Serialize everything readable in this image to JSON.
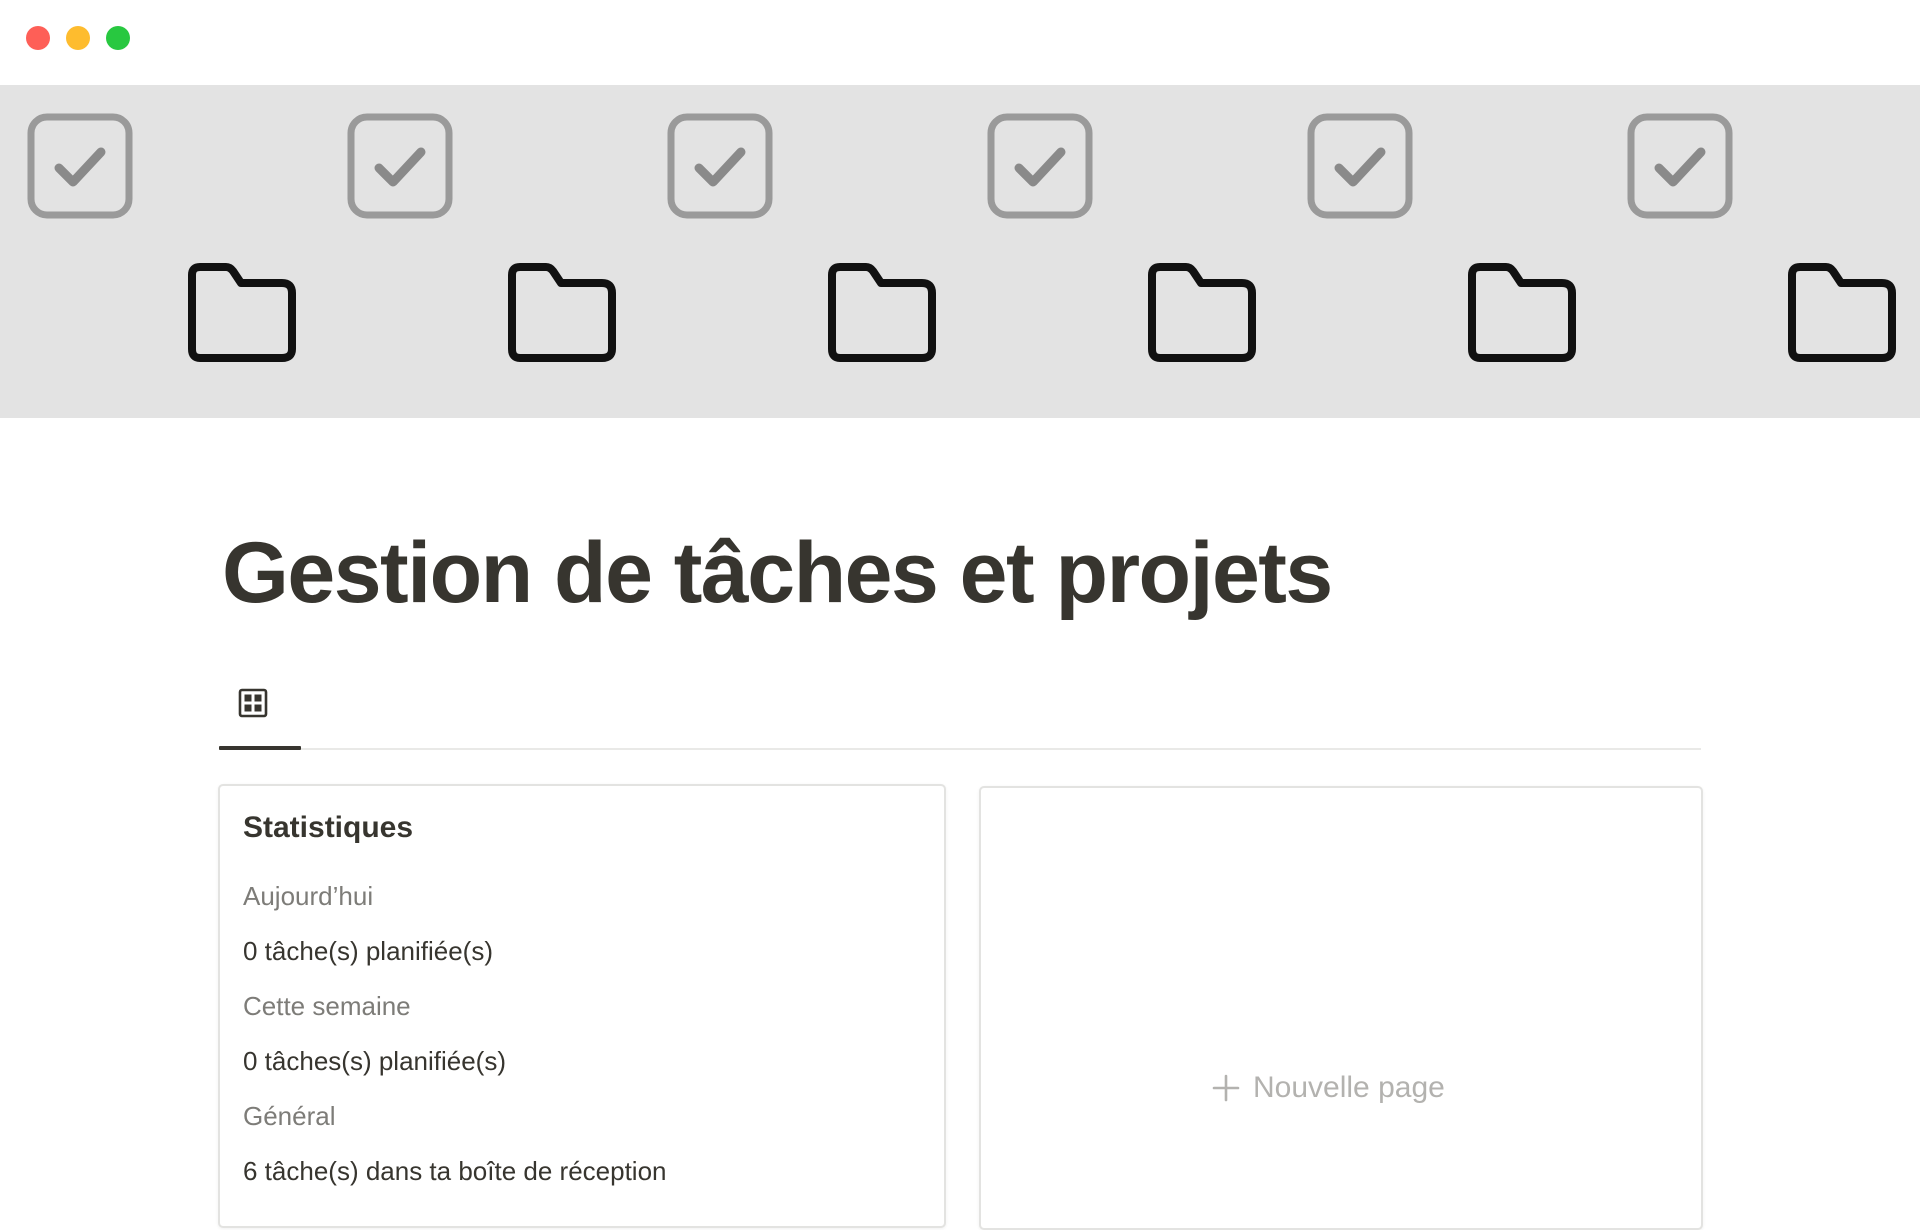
{
  "window": {
    "controls": [
      "close",
      "minimize",
      "maximize"
    ],
    "colors": {
      "close": "#fe5f57",
      "minimize": "#febc2e",
      "maximize": "#28c840"
    }
  },
  "cover": {
    "background": "#e3e3e3",
    "pattern_icons": [
      "checkbox-icon",
      "folder-icon"
    ]
  },
  "page": {
    "title": "Gestion de tâches et projets"
  },
  "views": {
    "tabs": [
      {
        "icon": "gallery-grid-icon",
        "active": true
      }
    ]
  },
  "stats_card": {
    "heading": "Statistiques",
    "sections": [
      {
        "label": "Aujourd’hui",
        "value": "0 tâche(s) planifiée(s)"
      },
      {
        "label": "Cette semaine",
        "value": "0 tâches(s) planifiée(s)"
      },
      {
        "label": "Général",
        "value": "6 tâche(s) dans ta boîte de réception"
      }
    ]
  },
  "new_page_card": {
    "label": "Nouvelle page",
    "icon": "plus-icon"
  },
  "colors": {
    "text": "#37352f",
    "muted": "#7d7c78",
    "placeholder": "#b3b2af",
    "divider": "#e9e9e7"
  }
}
